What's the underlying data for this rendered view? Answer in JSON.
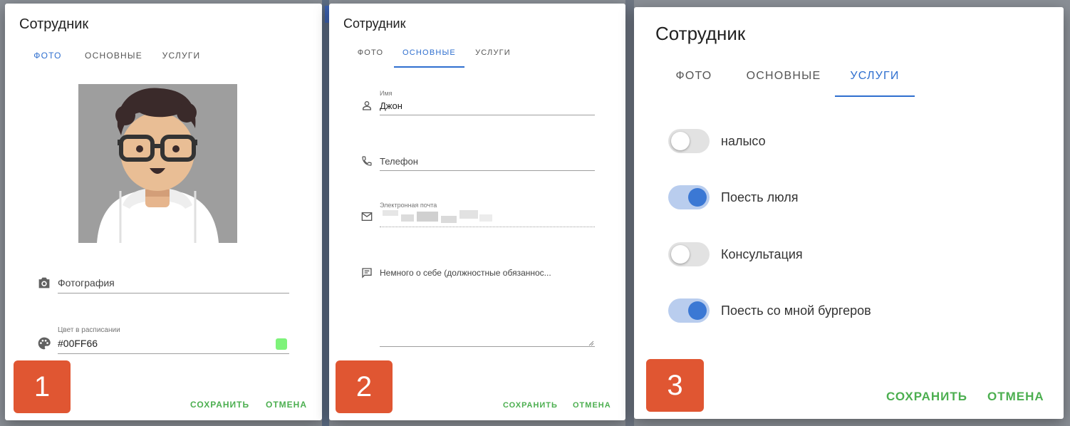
{
  "dialog1": {
    "title": "Сотрудник",
    "tabs": [
      {
        "label": "ФОТО",
        "active": true
      },
      {
        "label": "ОСНОВНЫЕ",
        "active": false
      },
      {
        "label": "УСЛУГИ",
        "active": false
      }
    ],
    "photo_label": "Фотография",
    "color_label": "Цвет в расписании",
    "color_value": "#00FF66",
    "swatch_color": "#7ef37a",
    "save": "СОХРАНИТЬ",
    "cancel": "ОТМЕНА",
    "badge": "1"
  },
  "dialog2": {
    "title": "Сотрудник",
    "tabs": [
      {
        "label": "ФОТО",
        "active": false
      },
      {
        "label": "ОСНОВНЫЕ",
        "active": true
      },
      {
        "label": "УСЛУГИ",
        "active": false
      }
    ],
    "name_label": "Имя",
    "name_value": "Джон",
    "phone_label": "Телефон",
    "email_label": "Электронная почта",
    "about_label": "Немного о себе (должностные обязаннос...",
    "save": "СОХРАНИТЬ",
    "cancel": "ОТМЕНА",
    "badge": "2"
  },
  "dialog3": {
    "title": "Сотрудник",
    "tabs": [
      {
        "label": "ФОТО",
        "active": false
      },
      {
        "label": "ОСНОВНЫЕ",
        "active": false
      },
      {
        "label": "УСЛУГИ",
        "active": true
      }
    ],
    "services": [
      {
        "label": "налысо",
        "enabled": false
      },
      {
        "label": "Поесть люля",
        "enabled": true
      },
      {
        "label": "Консультация",
        "enabled": false
      },
      {
        "label": "Поесть со мной бургеров",
        "enabled": true
      }
    ],
    "save": "СОХРАНИТЬ",
    "cancel": "ОТМЕНА",
    "badge": "3"
  },
  "colors": {
    "accent": "#2f6fcf",
    "button_green": "#4caf50",
    "badge": "#e05632"
  }
}
